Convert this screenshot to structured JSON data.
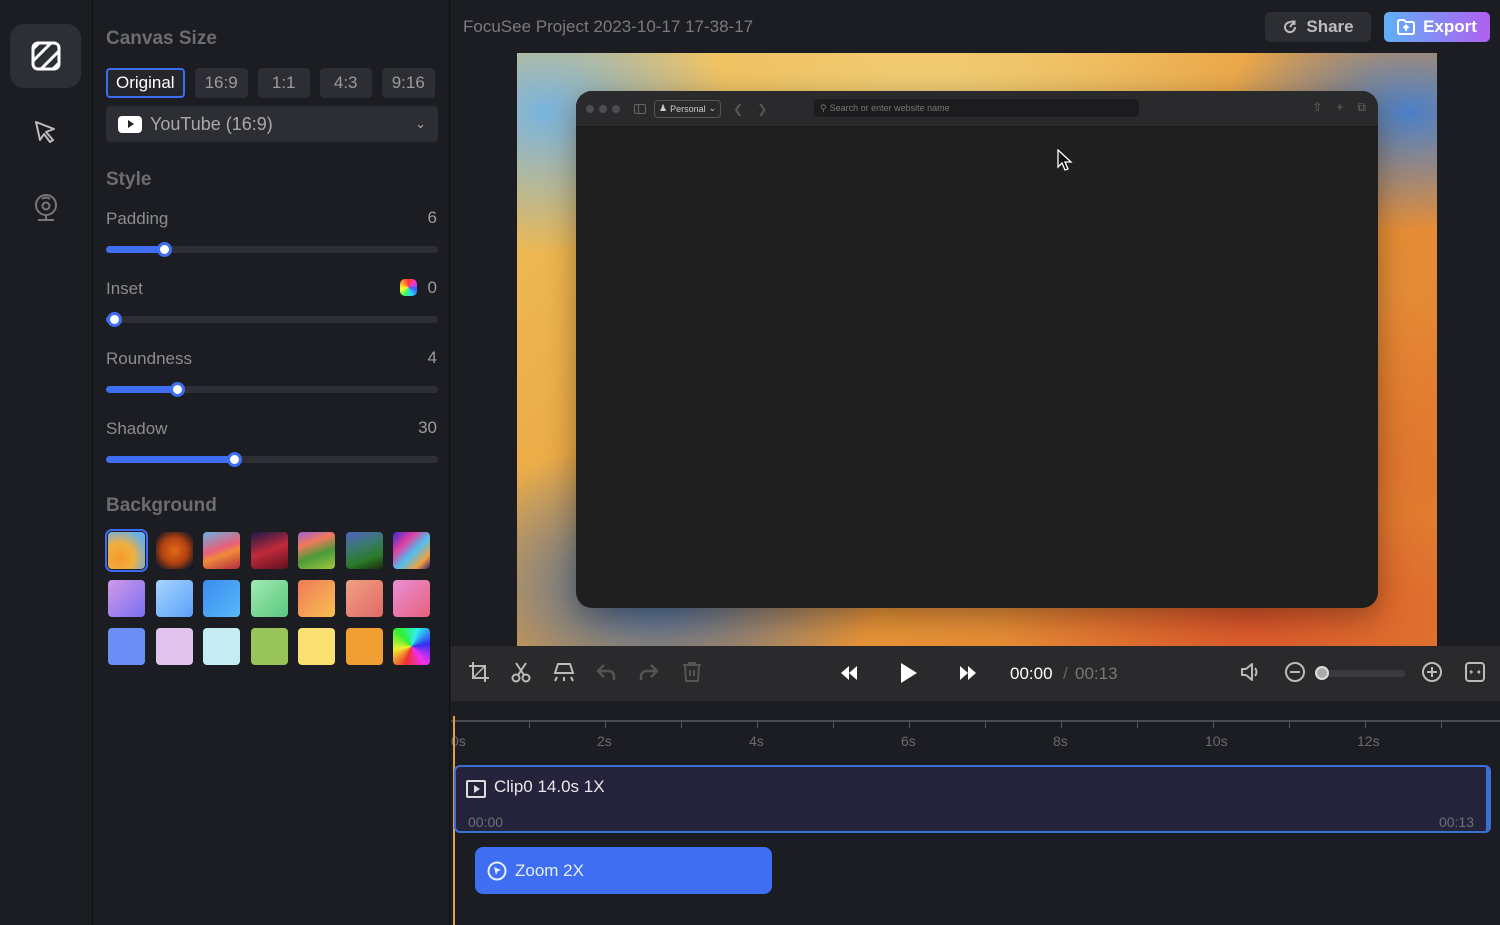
{
  "rail": {
    "items": [
      {
        "name": "background-style",
        "icon": "striped-square-icon",
        "active": true
      },
      {
        "name": "cursor",
        "icon": "cursor-arrow-icon",
        "active": false
      },
      {
        "name": "camera",
        "icon": "webcam-icon",
        "active": false
      }
    ]
  },
  "panel": {
    "canvas_size_title": "Canvas Size",
    "ratios": [
      "Original",
      "16:9",
      "1:1",
      "4:3",
      "9:16"
    ],
    "selected_ratio": "Original",
    "preset": {
      "icon": "youtube-icon",
      "label": "YouTube (16:9)"
    },
    "style_title": "Style",
    "sliders": [
      {
        "label": "Padding",
        "value": "6",
        "fraction": 0.175
      },
      {
        "label": "Inset",
        "value": "0",
        "fraction": 0.0
      },
      {
        "label": "Roundness",
        "value": "4",
        "fraction": 0.215
      },
      {
        "label": "Shadow",
        "value": "30",
        "fraction": 0.385
      }
    ],
    "background_title": "Background",
    "backgrounds": [
      {
        "name": "ventura-light",
        "style": "radial-gradient(circle at 30% 70%, #f39a2a, #f0b040 40%, #6ab0e8 80%)",
        "selected": true
      },
      {
        "name": "ventura-dark",
        "style": "radial-gradient(circle at 50% 50%, #e26a1a, #b04010 50%, #101828 90%)"
      },
      {
        "name": "bigsur-light",
        "style": "linear-gradient(160deg, #6ab0e0 0%, #e8607a 45%, #f08a3a 60%, #b02a40 100%)"
      },
      {
        "name": "bigsur-dark",
        "style": "linear-gradient(160deg, #1a1a48 0%, #c02a3a 50%, #601020 100%)"
      },
      {
        "name": "sonoma-light",
        "style": "linear-gradient(160deg, #a060d0 0%, #f07a5a 30%, #4a9a3a 60%, #a0c840 100%)"
      },
      {
        "name": "sonoma-dark",
        "style": "linear-gradient(160deg, #5060c0 0%, #3a7a6a 40%, #2a7a2a 70%, #1a2a10 100%)"
      },
      {
        "name": "abstract-waves",
        "style": "linear-gradient(135deg, #3a2ad0 0%, #e040a0 30%, #50c0f0 55%, #f0a040 80%, #2a1a70 100%)"
      },
      {
        "name": "purple-gradient",
        "style": "linear-gradient(135deg, #d09ae8, #7a6ef0)"
      },
      {
        "name": "sky-gradient",
        "style": "linear-gradient(135deg, #a8d4ff, #5aa0f8)"
      },
      {
        "name": "blue-gradient",
        "style": "linear-gradient(135deg, #3a8ef0, #5ab8f8)"
      },
      {
        "name": "mint-gradient",
        "style": "linear-gradient(135deg, #a0eab0, #5ac880)"
      },
      {
        "name": "orange-gradient",
        "style": "linear-gradient(135deg, #f07a5a, #f8c050)"
      },
      {
        "name": "salmon-gradient",
        "style": "linear-gradient(135deg, #f0a080, #e06a6a)"
      },
      {
        "name": "pink-gradient",
        "style": "linear-gradient(135deg, #e890d8, #e8607a)"
      },
      {
        "name": "solid-blue",
        "style": "#6a8ef5"
      },
      {
        "name": "solid-lavender",
        "style": "#e0c4ec"
      },
      {
        "name": "solid-light-cyan",
        "style": "#c4ecf2"
      },
      {
        "name": "solid-olive-green",
        "style": "#98c45a"
      },
      {
        "name": "solid-yellow",
        "style": "#fae070"
      },
      {
        "name": "solid-orange",
        "style": "#f0a032"
      },
      {
        "name": "rainbow-conic",
        "style": "conic-gradient(from 200deg, #f03030, #f0f030, #30f030, #30f0f0, #3030f0, #f030f0, #f03030)"
      }
    ]
  },
  "header": {
    "project_title": "FocuSee Project 2023-10-17 17-38-17",
    "share_label": "Share",
    "export_label": "Export"
  },
  "preview": {
    "browser": {
      "profile_label": "Personal",
      "address_placeholder": "Search or enter website name"
    }
  },
  "controls": {
    "current_time": "00:00",
    "separator": "/",
    "total_time": "00:13",
    "zoom_level_fraction": 0.0
  },
  "timeline": {
    "ticks": [
      "0s",
      "2s",
      "4s",
      "6s",
      "8s",
      "10s",
      "12s"
    ],
    "clip": {
      "title": "Clip0 14.0s 1X",
      "start": "00:00",
      "end": "00:13"
    },
    "zoom_block": {
      "label": "Zoom 2X"
    }
  }
}
